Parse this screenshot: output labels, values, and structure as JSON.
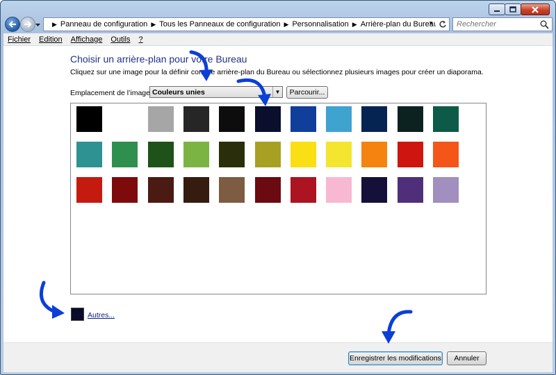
{
  "window": {
    "controls": [
      "minimize",
      "maximize",
      "close"
    ]
  },
  "address_bar": {
    "crumbs": [
      "Panneau de configuration",
      "Tous les Panneaux de configuration",
      "Personnalisation",
      "Arrière-plan du Bureau"
    ],
    "search_placeholder": "Rechercher"
  },
  "menu": {
    "items": [
      "Fichier",
      "Edition",
      "Affichage",
      "Outils",
      "?"
    ]
  },
  "main": {
    "heading": "Choisir un arrière-plan pour votre Bureau",
    "subtext": "Cliquez sur une image pour la définir comme arrière-plan du Bureau ou sélectionnez plusieurs images pour créer un diaporama.",
    "location_label": "Emplacement de l’image :",
    "location_value": "Couleurs unies",
    "browse_label": "Parcourir...",
    "others_label": "Autres..."
  },
  "colors": [
    [
      "#000000",
      "#ffffff",
      "#a6a6a6",
      "#262626",
      "#0d0d0d",
      "#0a0f2e",
      "#0f3e9b",
      "#3fa3d0",
      "#062452",
      "#0b2220",
      "#0e5a48"
    ],
    [
      "#2d9291",
      "#2f8f4f",
      "#1e5219",
      "#7cb443",
      "#2a2e0b",
      "#a8a023",
      "#fadf14",
      "#f4e530",
      "#f5830f",
      "#ce150f",
      "#f4561a"
    ],
    [
      "#c51a10",
      "#7e0b0c",
      "#4b1a12",
      "#361b0f",
      "#7d5c41",
      "#6b0a10",
      "#ab1420",
      "#f8b8d2",
      "#15103a",
      "#4f2f7a",
      "#a18fbf"
    ]
  ],
  "others_color": "#0a0a2a",
  "buttons": {
    "save": "Enregistrer les modifications",
    "cancel": "Annuler"
  },
  "accent_arrow_color": "#0b3fd6"
}
